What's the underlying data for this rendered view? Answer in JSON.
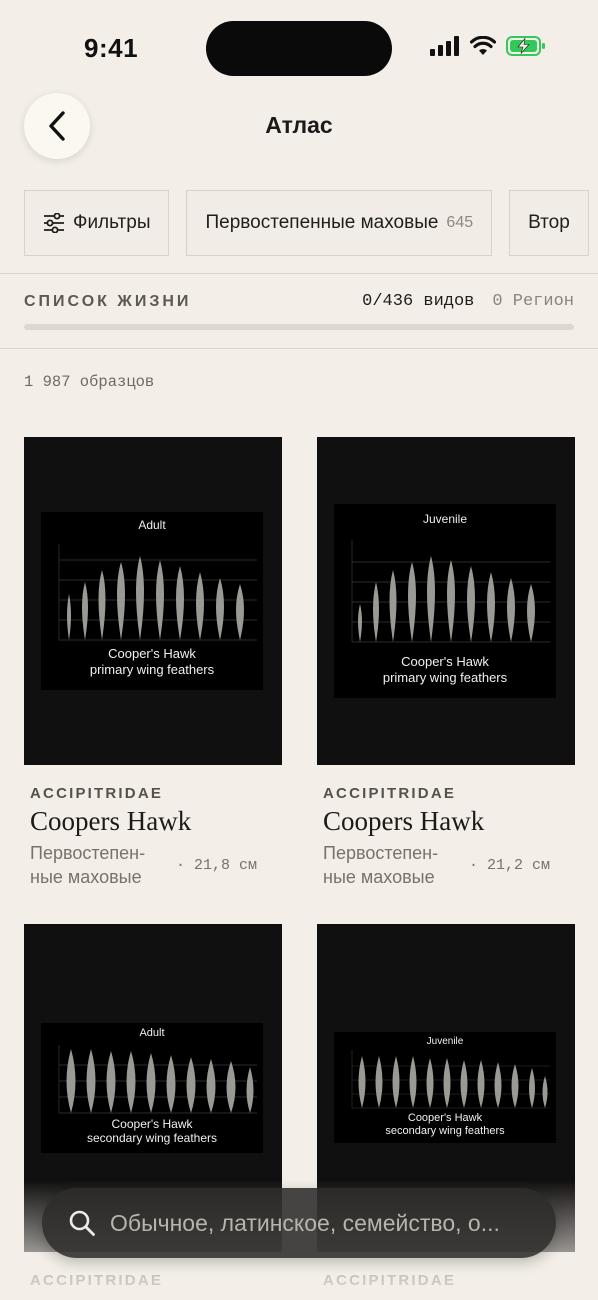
{
  "status": {
    "time": "9:41"
  },
  "header": {
    "title": "Атлас"
  },
  "filters": {
    "filter_label": "Фильтры",
    "chips": [
      {
        "label": "Первостепенные маховые",
        "count": "645"
      },
      {
        "label": "Втор"
      }
    ]
  },
  "life_list": {
    "label": "СПИСОК ЖИЗНИ",
    "species": "0/436 видов",
    "region": "0 Регион",
    "progress": 0
  },
  "specimen_count": "1 987 образцов",
  "cards": [
    {
      "family": "ACCIPITRIDAE",
      "name": "Coopers Hawk",
      "type": "Первостепен-ные маховые",
      "length": "· 21,8 см",
      "plate_title": "Adult",
      "plate_caption_1": "Cooper's Hawk",
      "plate_caption_2": "primary wing feathers"
    },
    {
      "family": "ACCIPITRIDAE",
      "name": "Coopers Hawk",
      "type": "Первостепен-ные маховые",
      "length": "· 21,2 см",
      "plate_title": "Juvenile",
      "plate_caption_1": "Cooper's Hawk",
      "plate_caption_2": "primary wing feathers"
    },
    {
      "family": "ACCIPITRIDAE",
      "plate_title": "Adult",
      "plate_caption_1": "Cooper's Hawk",
      "plate_caption_2": "secondary wing feathers"
    },
    {
      "family": "ACCIPITRIDAE",
      "plate_title": "Juvenile",
      "plate_caption_1": "Cooper's Hawk",
      "plate_caption_2": "secondary wing feathers"
    }
  ],
  "search": {
    "placeholder": "Обычное, латинское, семейство, о..."
  },
  "icons": [
    "signal-icon",
    "wifi-icon",
    "battery-charging-icon",
    "back-chevron-icon",
    "filter-sliders-icon",
    "search-icon"
  ],
  "colors": {
    "background": "#f3efe8",
    "battery": "#34c759"
  }
}
